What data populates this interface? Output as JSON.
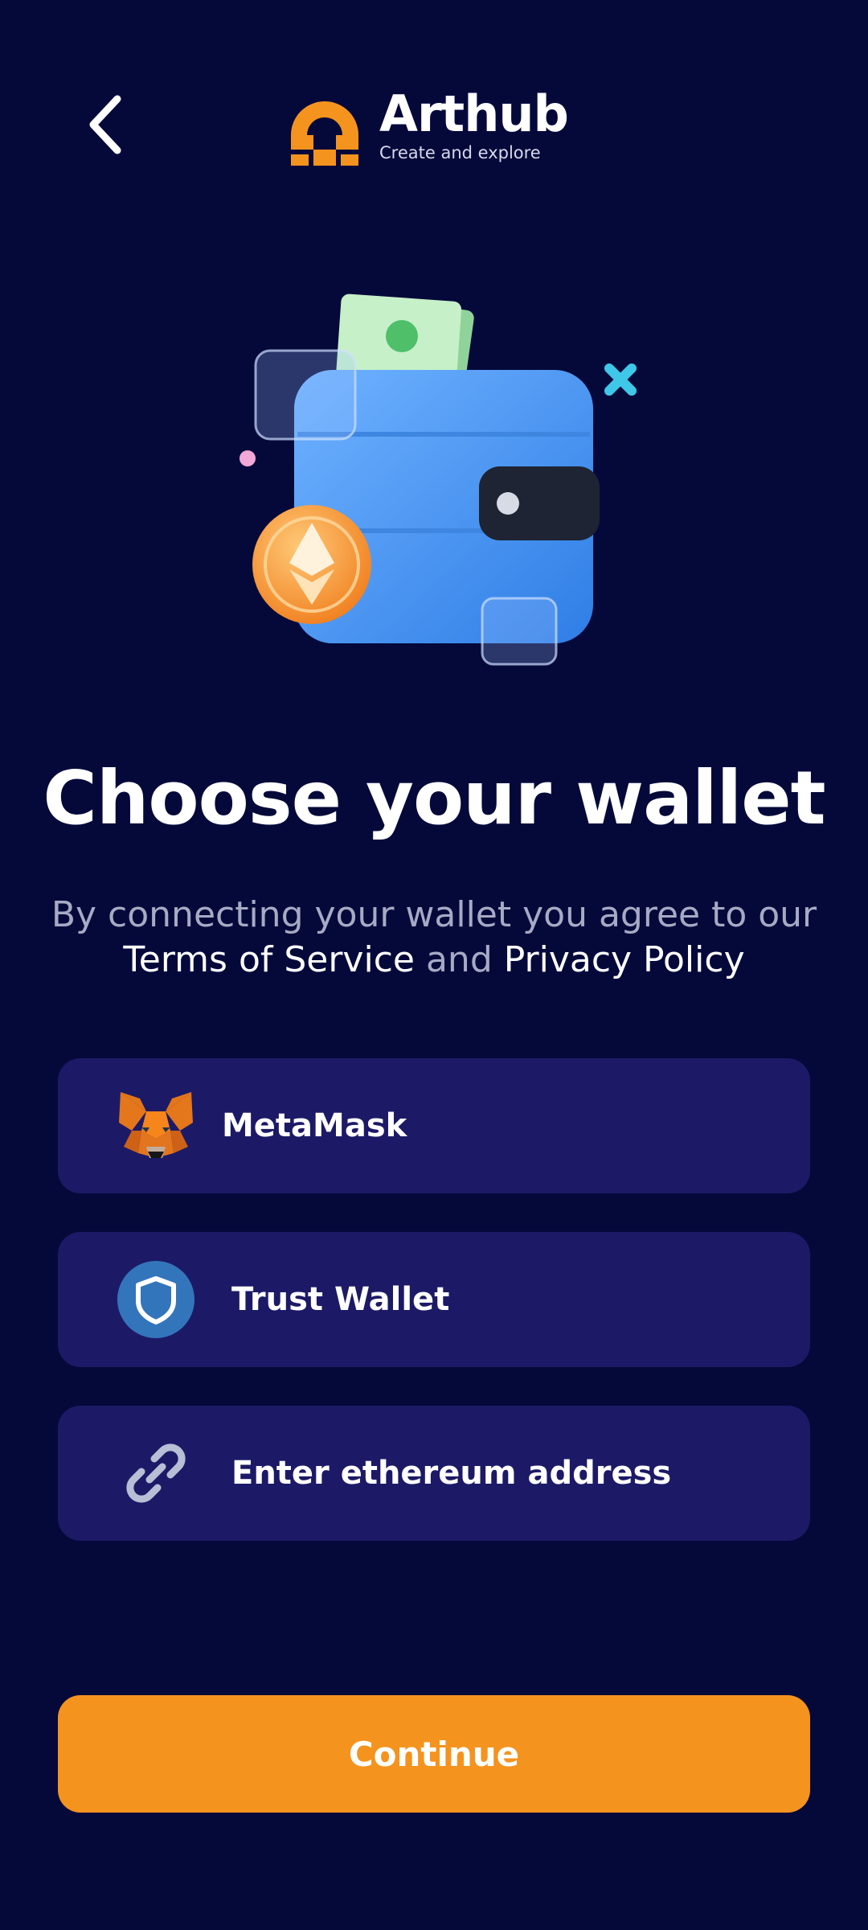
{
  "header": {
    "back_icon": "chevron-left-icon",
    "brand": {
      "name": "Arthub",
      "tagline": "Create and explore",
      "logo_icon": "arthub-logo",
      "logo_color": "#f5931f"
    }
  },
  "hero": {
    "illustration": "wallet-illustration"
  },
  "main": {
    "title": "Choose your wallet",
    "subtitle": {
      "prefix": "By connecting your wallet you agree to our",
      "terms_link": "Terms of Service",
      "joiner": "and",
      "privacy_link": "Privacy Policy"
    }
  },
  "wallet_options": [
    {
      "label": "MetaMask",
      "icon": "metamask-fox-icon"
    },
    {
      "label": "Trust Wallet",
      "icon": "trust-wallet-shield-icon"
    },
    {
      "label": "Enter ethereum address",
      "icon": "link-icon"
    }
  ],
  "footer": {
    "continue_label": "Continue"
  },
  "colors": {
    "background": "#05093a",
    "option_background": "#1c1a66",
    "accent": "#f5931f",
    "muted_text": "#a7aac4"
  }
}
